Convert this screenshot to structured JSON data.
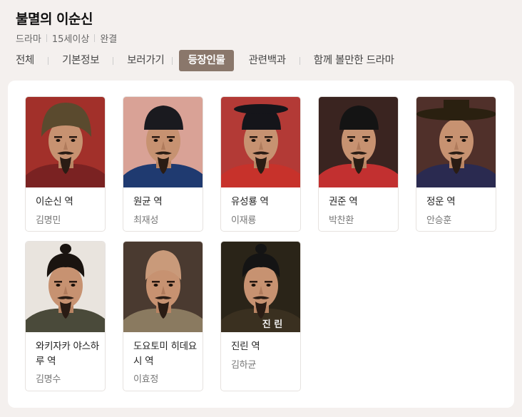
{
  "title": "불멸의 이순신",
  "meta": {
    "genre": "드라마",
    "rating": "15세이상",
    "status": "완결"
  },
  "tabs": [
    {
      "label": "전체",
      "active": false
    },
    {
      "label": "기본정보",
      "active": false
    },
    {
      "label": "보러가기",
      "active": false
    },
    {
      "label": "등장인물",
      "active": true
    },
    {
      "label": "관련백과",
      "active": false
    },
    {
      "label": "함께 볼만한 드라마",
      "active": false
    }
  ],
  "colors": {
    "active_tab": "#8a776b",
    "page_bg": "#f4f0ee",
    "panel_bg": "#ffffff"
  },
  "cast": [
    {
      "role": "이순신 역",
      "actor": "김명민",
      "photo": {
        "bg": "#a2302a",
        "hat": "fur",
        "hat_color": "#5a4a2e",
        "robe": "#7a2222",
        "beard": true
      }
    },
    {
      "role": "원균 역",
      "actor": "최재성",
      "photo": {
        "bg": "#d9a296",
        "hat": "cap",
        "hat_color": "#1a1a1f",
        "robe": "#1f3a70",
        "beard": true
      }
    },
    {
      "role": "유성룡 역",
      "actor": "이재룡",
      "photo": {
        "bg": "#b33a36",
        "hat": "official",
        "hat_color": "#15151a",
        "robe": "#c7322b",
        "beard": true
      }
    },
    {
      "role": "권준 역",
      "actor": "박찬환",
      "photo": {
        "bg": "#3a2420",
        "hat": "cap",
        "hat_color": "#141414",
        "robe": "#c23030",
        "beard": true
      }
    },
    {
      "role": "정운 역",
      "actor": "안승훈",
      "photo": {
        "bg": "#50302a",
        "hat": "gat",
        "hat_color": "#2a2010",
        "robe": "#2a2a50",
        "beard": true
      }
    },
    {
      "role": "와키자카 야스하루 역",
      "actor": "김명수",
      "photo": {
        "bg": "#e9e4de",
        "hat": "topknot",
        "hat_color": "#1a1410",
        "robe": "#4a4a3a",
        "beard": true
      }
    },
    {
      "role": "도요토미 히데요시 역",
      "actor": "이효정",
      "photo": {
        "bg": "#4a3a30",
        "hat": "bald",
        "hat_color": "#c99a7a",
        "robe": "#8a7a60",
        "beard": true
      }
    },
    {
      "role": "진린 역",
      "actor": "김하균",
      "photo": {
        "bg": "#2a2418",
        "hat": "topknot",
        "hat_color": "#141414",
        "robe": "#3a3020",
        "beard": true,
        "caption": "진 린"
      }
    }
  ]
}
